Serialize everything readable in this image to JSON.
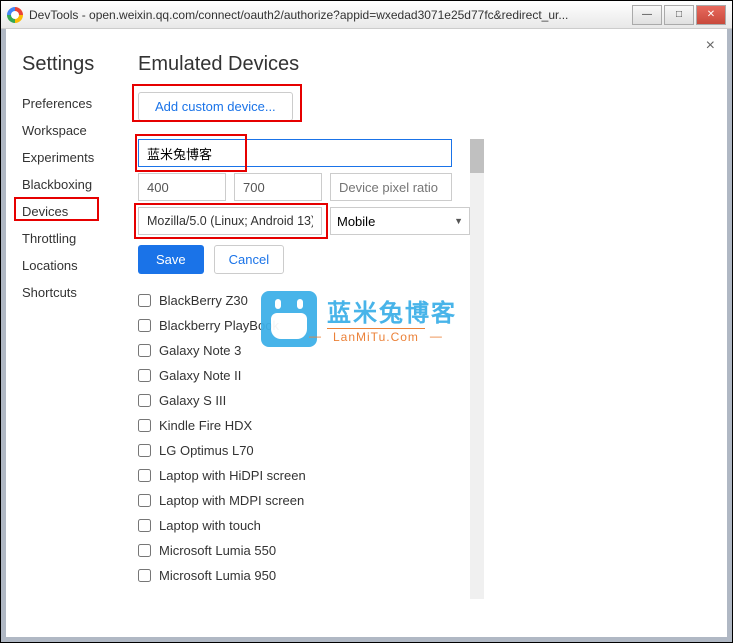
{
  "window": {
    "title": "DevTools - open.weixin.qq.com/connect/oauth2/authorize?appid=wxedad3071e25d77fc&redirect_ur..."
  },
  "sidebar": {
    "title": "Settings",
    "items": [
      {
        "label": "Preferences"
      },
      {
        "label": "Workspace"
      },
      {
        "label": "Experiments"
      },
      {
        "label": "Blackboxing"
      },
      {
        "label": "Devices",
        "active": true
      },
      {
        "label": "Throttling"
      },
      {
        "label": "Locations"
      },
      {
        "label": "Shortcuts"
      }
    ]
  },
  "main": {
    "title": "Emulated Devices",
    "add_button": "Add custom device...",
    "form": {
      "name_value": "蓝米兔博客",
      "width": "400",
      "height": "700",
      "dpr_placeholder": "Device pixel ratio",
      "ua": "Mozilla/5.0 (Linux; Android 13)",
      "type_label": "Mobile",
      "save": "Save",
      "cancel": "Cancel"
    },
    "devices": [
      "BlackBerry Z30",
      "Blackberry PlayBook",
      "Galaxy Note 3",
      "Galaxy Note II",
      "Galaxy S III",
      "Kindle Fire HDX",
      "LG Optimus L70",
      "Laptop with HiDPI screen",
      "Laptop with MDPI screen",
      "Laptop with touch",
      "Microsoft Lumia 550",
      "Microsoft Lumia 950"
    ]
  },
  "watermark": {
    "title": "蓝米兔博客",
    "sub": "LanMiTu.Com"
  }
}
